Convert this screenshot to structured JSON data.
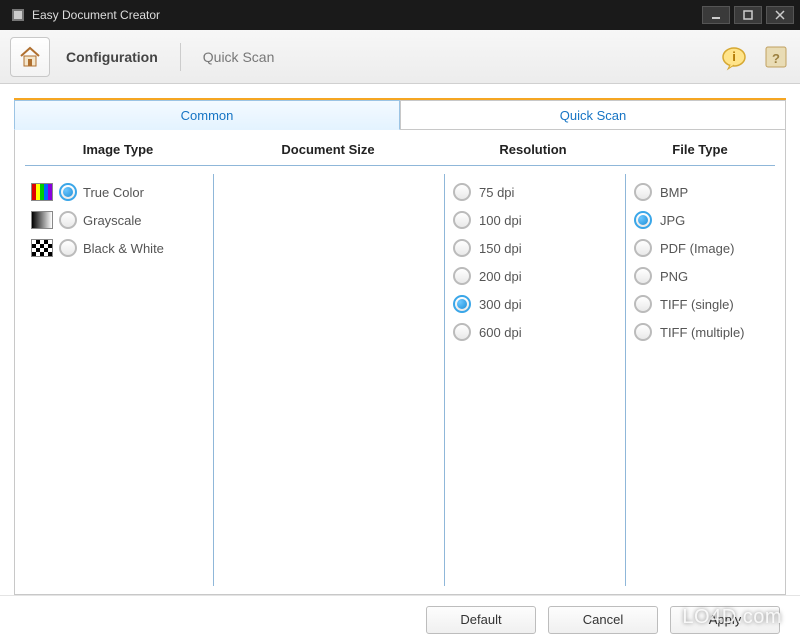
{
  "window": {
    "title": "Easy Document Creator"
  },
  "toolbar": {
    "breadcrumb1": "Configuration",
    "breadcrumb2": "Quick Scan"
  },
  "tabs": {
    "common": "Common",
    "quickscan": "Quick Scan"
  },
  "columns": {
    "image_type": "Image Type",
    "document_size": "Document Size",
    "resolution": "Resolution",
    "file_type": "File Type"
  },
  "image_type": {
    "options": [
      {
        "label": "True Color",
        "swatch": "color",
        "selected": true
      },
      {
        "label": "Grayscale",
        "swatch": "gray",
        "selected": false
      },
      {
        "label": "Black & White",
        "swatch": "bw",
        "selected": false
      }
    ]
  },
  "resolution": {
    "options": [
      {
        "label": "75 dpi",
        "selected": false
      },
      {
        "label": "100 dpi",
        "selected": false
      },
      {
        "label": "150 dpi",
        "selected": false
      },
      {
        "label": "200 dpi",
        "selected": false
      },
      {
        "label": "300 dpi",
        "selected": true
      },
      {
        "label": "600 dpi",
        "selected": false
      }
    ]
  },
  "file_type": {
    "options": [
      {
        "label": "BMP",
        "selected": false
      },
      {
        "label": "JPG",
        "selected": true
      },
      {
        "label": "PDF (Image)",
        "selected": false
      },
      {
        "label": "PNG",
        "selected": false
      },
      {
        "label": "TIFF (single)",
        "selected": false
      },
      {
        "label": "TIFF (multiple)",
        "selected": false
      }
    ]
  },
  "buttons": {
    "default": "Default",
    "cancel": "Cancel",
    "apply": "Apply"
  },
  "watermark": "LO4D.com"
}
